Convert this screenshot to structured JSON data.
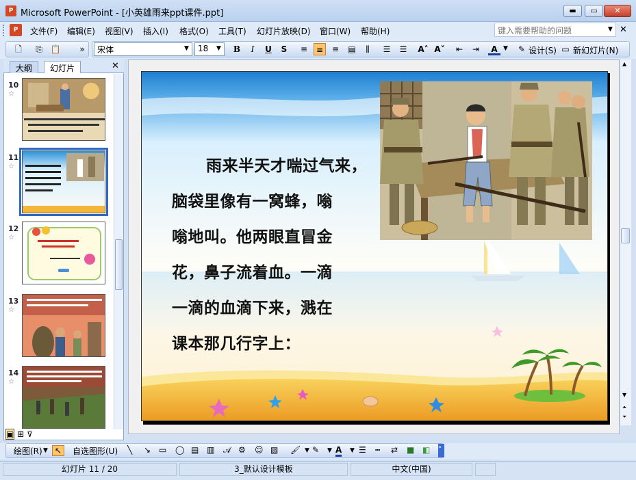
{
  "window": {
    "app_name": "Microsoft PowerPoint",
    "title": "Microsoft PowerPoint - [小英雄雨来ppt课件.ppt]",
    "minimize": "▬",
    "maximize": "▭",
    "close": "✕"
  },
  "menu": {
    "items": [
      "文件(F)",
      "编辑(E)",
      "视图(V)",
      "插入(I)",
      "格式(O)",
      "工具(T)",
      "幻灯片放映(D)",
      "窗口(W)",
      "帮助(H)"
    ],
    "help_placeholder": "键入需要帮助的问题"
  },
  "toolbar": {
    "font_name": "宋体",
    "font_size": "18",
    "bold": "B",
    "italic": "I",
    "underline": "U",
    "shadow": "S",
    "design_label": "设计(S)",
    "new_slide_label": "新幻灯片(N)"
  },
  "left_pane": {
    "tabs": [
      "大纲",
      "幻灯片"
    ],
    "active_tab": "幻灯片",
    "slides": [
      {
        "number": "10",
        "star": "☆",
        "top": 0
      },
      {
        "number": "11",
        "star": "☆",
        "selected": true
      },
      {
        "number": "12",
        "star": "☆"
      },
      {
        "number": "13",
        "star": "☆"
      },
      {
        "number": "14",
        "star": "☆"
      }
    ]
  },
  "slide": {
    "text_lines": [
      "雨来半天才喘过气来，",
      "脑袋里像有一窝蜂，嗡",
      "嗡地叫。他两眼直冒金",
      "花，鼻子流着血。一滴",
      "一滴的血滴下来，溅在",
      "课本那几行字上："
    ]
  },
  "drawing_toolbar": {
    "draw_label": "绘图(R)",
    "autoshapes_label": "自选图形(U)"
  },
  "status": {
    "slide_position": "幻灯片 11 / 20",
    "template": "3_默认设计模板",
    "language": "中文(中国)"
  },
  "colors": {
    "office_blue": "#316ac5",
    "toolbar_bg": "#dfeaf8",
    "slide_sky": "#2a8fd6",
    "sand": "#f5b73a"
  }
}
